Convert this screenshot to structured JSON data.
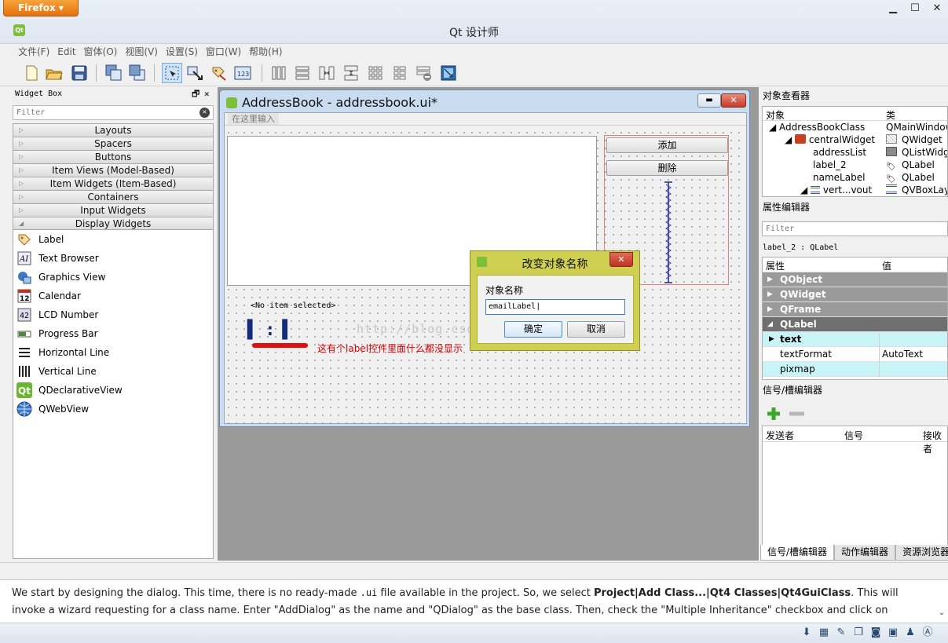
{
  "browser": {
    "button_label": "Firefox",
    "window_controls": [
      "minimize-icon",
      "maximize-icon",
      "close-icon"
    ]
  },
  "app": {
    "title": "Qt 设计师"
  },
  "menu": [
    "文件(F)",
    "Edit",
    "窗体(O)",
    "视图(V)",
    "设置(S)",
    "窗口(W)",
    "帮助(H)"
  ],
  "toolbar": {
    "icons": [
      "new-file-icon",
      "open-folder-icon",
      "save-icon",
      "send-to-back-icon",
      "bring-to-front-icon",
      "edit-widgets-icon",
      "edit-signals-slots-icon",
      "edit-buddies-icon",
      "edit-tab-order-icon",
      "layout-horizontal-icon",
      "layout-vertical-icon",
      "layout-horizontal-splitter-icon",
      "layout-vertical-splitter-icon",
      "layout-grid-icon",
      "layout-form-icon",
      "break-layout-icon",
      "adjust-size-icon"
    ]
  },
  "widget_box": {
    "title": "Widget Box",
    "filter_placeholder": "Filter",
    "categories": [
      "Layouts",
      "Spacers",
      "Buttons",
      "Item Views (Model-Based)",
      "Item Widgets (Item-Based)",
      "Containers",
      "Input Widgets",
      "Display Widgets"
    ],
    "items": [
      {
        "label": "Label",
        "icon": "label-tag-icon"
      },
      {
        "label": "Text Browser",
        "icon": "text-browser-icon"
      },
      {
        "label": "Graphics View",
        "icon": "graphics-view-icon"
      },
      {
        "label": "Calendar",
        "icon": "calendar-icon"
      },
      {
        "label": "LCD Number",
        "icon": "lcd-number-icon"
      },
      {
        "label": "Progress Bar",
        "icon": "progress-bar-icon"
      },
      {
        "label": "Horizontal Line",
        "icon": "horizontal-line-icon"
      },
      {
        "label": "Vertical Line",
        "icon": "vertical-line-icon"
      },
      {
        "label": "QDeclarativeView",
        "icon": "qt-logo-icon"
      },
      {
        "label": "QWebView",
        "icon": "globe-icon"
      }
    ]
  },
  "form_window": {
    "title": "AddressBook - addressbook.ui*",
    "type_here": "在这里输入",
    "add_button": "添加",
    "delete_button": "删除",
    "no_item_text": "<No item selected>",
    "label_placeholder": ":",
    "annotation": "这有个label控件里面什么都没显示",
    "watermark": "http://blog.csdn.net/jing_9668"
  },
  "rename_dialog": {
    "title": "改变对象名称",
    "field_label": "对象名称",
    "field_value": "emailLabel",
    "ok": "确定",
    "cancel": "取消"
  },
  "object_inspector": {
    "title": "对象查看器",
    "col_object": "对象",
    "col_class": "类",
    "rows": [
      {
        "name": "AddressBookClass",
        "cls": "QMainWindow",
        "level": 0
      },
      {
        "name": "centralWidget",
        "cls": "QWidget",
        "level": 1
      },
      {
        "name": "addressList",
        "cls": "QListWidget",
        "level": 2
      },
      {
        "name": "label_2",
        "cls": "QLabel",
        "level": 2
      },
      {
        "name": "nameLabel",
        "cls": "QLabel",
        "level": 2
      },
      {
        "name": "vert...vout",
        "cls": "QVBoxLayout",
        "level": 2
      }
    ]
  },
  "property_editor": {
    "title": "属性编辑器",
    "filter_placeholder": "Filter",
    "object_line": "label_2 : QLabel",
    "col_property": "属性",
    "col_value": "值",
    "groups": [
      "QObject",
      "QWidget",
      "QFrame",
      "QLabel"
    ],
    "props": [
      {
        "name": "text",
        "value": ""
      },
      {
        "name": "textFormat",
        "value": "AutoText"
      },
      {
        "name": "pixmap",
        "value": ""
      }
    ]
  },
  "signal_editor": {
    "title": "信号/槽编辑器",
    "col_sender": "发送者",
    "col_signal": "信号",
    "col_receiver": "接收者"
  },
  "right_tabs": [
    "信号/槽编辑器",
    "动作编辑器",
    "资源浏览器"
  ],
  "bottom_text": {
    "line1_a": "We start by designing the dialog. This time, there is no ready-made ",
    "line1_code": ".ui",
    "line1_b": " file available in the project. So, we select ",
    "line1_bold": "Project|Add Class...|Qt4 Classes|Qt4GuiClass",
    "line1_c": ". This",
    "line2": "will invoke a wizard requesting for a class name. Enter \"AddDialog\" as the name and \"QDialog\" as the base class. Then, check the \"Multiple Inheritance\" checkbox and click on"
  },
  "colors": {
    "dialog_bg": "#cfcf52",
    "annotation_red": "#d40000",
    "selected_group": "#6f6f6f",
    "cyan_row": "#c8f4f8"
  }
}
